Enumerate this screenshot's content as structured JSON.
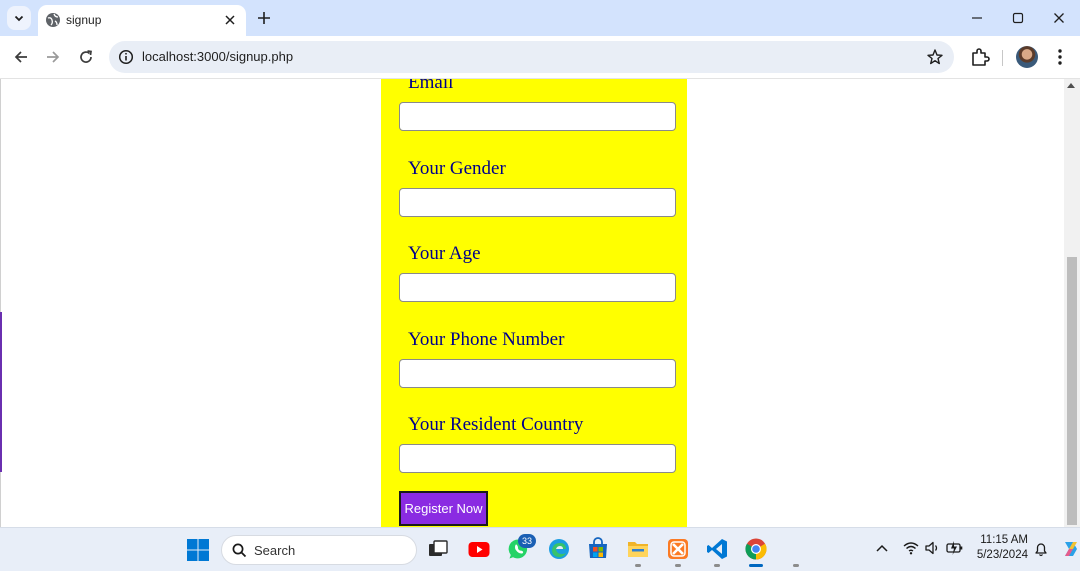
{
  "browser": {
    "tab_title": "signup",
    "url": "localhost:3000/signup.php"
  },
  "form": {
    "fields": [
      {
        "label": "Email",
        "value": ""
      },
      {
        "label": "Your Gender",
        "value": ""
      },
      {
        "label": "Your Age",
        "value": ""
      },
      {
        "label": "Your Phone Number",
        "value": ""
      },
      {
        "label": "Your Resident Country",
        "value": ""
      }
    ],
    "submit_label": "Register Now",
    "panel_color": "#ffff00",
    "label_color": "#00008b",
    "button_color": "#8a2be2"
  },
  "taskbar": {
    "search_placeholder": "Search",
    "whatsapp_badge": "33",
    "time": "11:15 AM",
    "date": "5/23/2024",
    "apps": [
      "start-icon",
      "task-view-icon",
      "youtube-icon",
      "whatsapp-icon",
      "edge-icon",
      "store-icon",
      "file-explorer-icon",
      "xampp-icon",
      "vscode-icon",
      "chrome-icon"
    ]
  }
}
